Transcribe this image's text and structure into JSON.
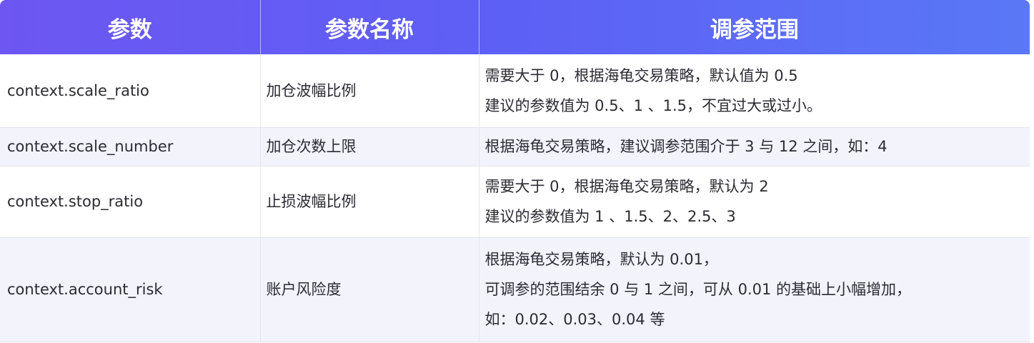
{
  "table": {
    "headers": [
      "参数",
      "参数名称",
      "调参范围"
    ],
    "rows": [
      {
        "param": "context.scale_ratio",
        "name": "加仓波幅比例",
        "range": [
          "需要大于 0，根据海龟交易策略，默认值为 0.5",
          "建议的参数值为 0.5、1 、1.5，不宜过大或过小。"
        ]
      },
      {
        "param": "context.scale_number",
        "name": "加仓次数上限",
        "range": [
          "根据海龟交易策略，建议调参范围介于 3 与 12 之间，如：4"
        ]
      },
      {
        "param": "context.stop_ratio",
        "name": "止损波幅比例",
        "range": [
          "需要大于 0，根据海龟交易策略，默认为 2",
          "建议的参数值为 1 、1.5、2、2.5、3"
        ]
      },
      {
        "param": "context.account_risk",
        "name": "账户风险度",
        "range": [
          "根据海龟交易策略，默认为 0.01，",
          "可调参的范围结余 0 与 1 之间，可从 0.01 的基础上小幅增加，",
          "如：0.02、0.03、0.04 等"
        ]
      }
    ]
  },
  "colors": {
    "header_start": "#6d56f2",
    "header_end": "#5a78f6",
    "row_alt": "#f3f3fb",
    "text": "#2b2b33"
  }
}
